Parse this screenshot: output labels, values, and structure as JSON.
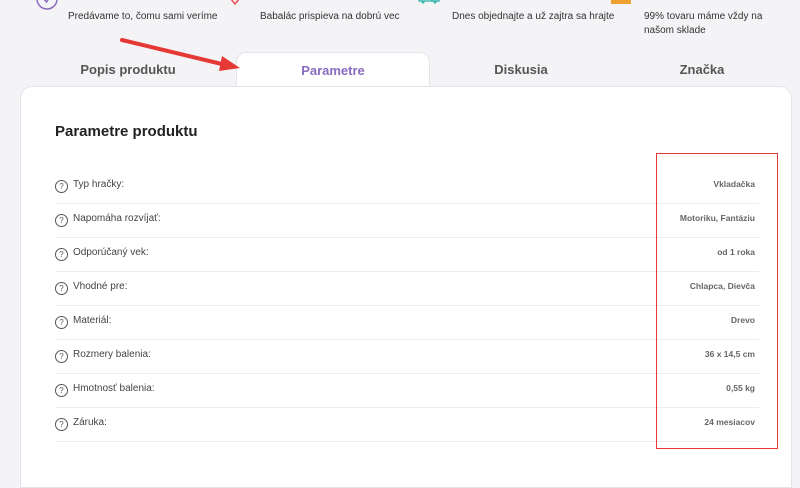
{
  "usps": [
    {
      "icon": "heart-check-icon",
      "text": "Predávame to, čomu sami veríme"
    },
    {
      "icon": "heart-hands-icon",
      "text": "Babalác prispieva na dobrú vec"
    },
    {
      "icon": "delivery-truck-icon",
      "text": "Dnes objednajte a už zajtra sa hrajte"
    },
    {
      "icon": "warehouse-boxes-icon",
      "text": "99% tovaru máme vždy na našom sklade"
    }
  ],
  "tabs": [
    {
      "label": "Popis produktu"
    },
    {
      "label": "Parametre"
    },
    {
      "label": "Diskusia"
    },
    {
      "label": "Značka"
    }
  ],
  "panel": {
    "title": "Parametre produktu",
    "rows": [
      {
        "label": "Typ hračky:",
        "value": "Vkladačka"
      },
      {
        "label": "Napomáha rozvíjať:",
        "value": "Motoriku, Fantáziu"
      },
      {
        "label": "Odporúčaný vek:",
        "value": "od 1 roka"
      },
      {
        "label": "Vhodné pre:",
        "value": "Chlapca, Dievča"
      },
      {
        "label": "Materiál:",
        "value": "Drevo"
      },
      {
        "label": "Rozmery balenia:",
        "value": "36 x 14,5 cm"
      },
      {
        "label": "Hmotnosť balenia:",
        "value": "0,55 kg"
      },
      {
        "label": "Záruka:",
        "value": "24 mesiacov"
      }
    ]
  },
  "help_glyph": "?",
  "colors": {
    "accent": "#8a6bbf",
    "annotation": "#e53935",
    "usp_purple": "#8a6bbf",
    "usp_red": "#e8555a",
    "usp_teal": "#3cb8b0",
    "usp_orange": "#f0a030"
  }
}
